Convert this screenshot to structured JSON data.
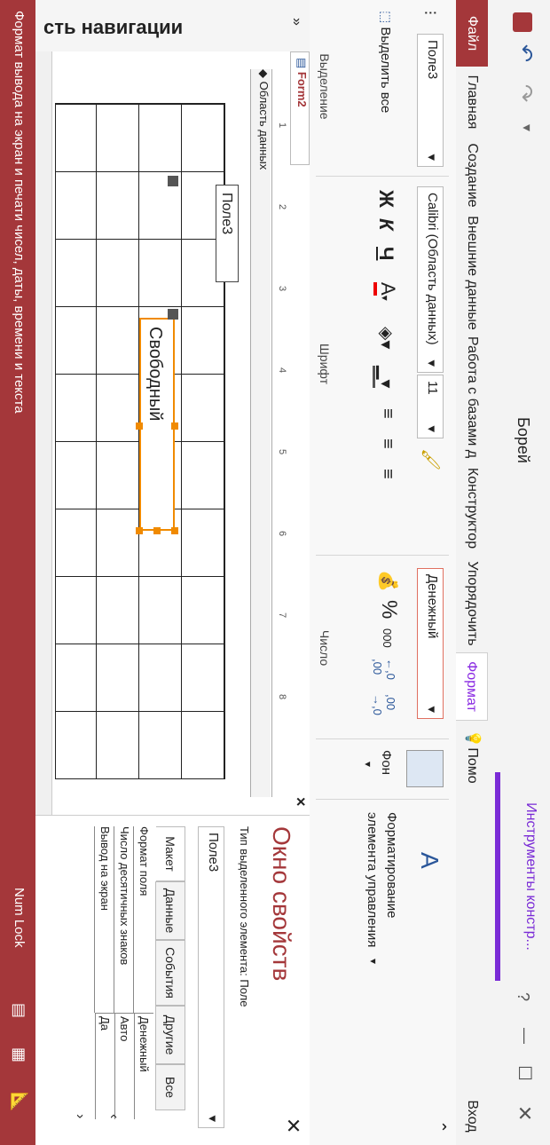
{
  "title_bar": {
    "doc_title": "Борей",
    "tools_context": "Инструменты констр...",
    "help_icon": "?",
    "minimize_icon": "—",
    "maximize_icon": "☐",
    "close_icon": "✕"
  },
  "tabs": {
    "file": "Файл",
    "home": "Главная",
    "create": "Создание",
    "external": "Внешние данные",
    "database": "Работа с базами д",
    "constructor": "Конструктор",
    "arrange": "Упорядочить",
    "format": "Формат",
    "help": "Помо",
    "signin": "Вход"
  },
  "ribbon": {
    "object_select_value": "Поле3",
    "select_all_label": "Выделить все",
    "selection_group": "Выделение",
    "font_select_value": "Calibri (Область данных)",
    "size_select_value": "11",
    "bold": "Ж",
    "italic": "К",
    "underline": "Ч",
    "font_color_letter": "A",
    "font_group": "Шрифт",
    "number_format_value": "Денежный",
    "percent": "%",
    "thousands": "000",
    "increase_decimal": "←,0 ,00",
    "decrease_decimal": ",00 →,0",
    "number_group": "Число",
    "background_label": "Фон",
    "conditional_label_1": "Форматирование",
    "conditional_label_2": "элемента управления"
  },
  "nav_pane": {
    "title": "сть навигации",
    "toggle": "»"
  },
  "document": {
    "tab_label": "Form2",
    "close": "×",
    "section_label": "Область данных",
    "ruler_marks": [
      "1",
      "2",
      "3",
      "4",
      "5",
      "6",
      "7",
      "8"
    ],
    "label_control": "Поле3",
    "text_control": "Свободный"
  },
  "property_sheet": {
    "title": "Окно свойств",
    "selection_type": "Тип выделенного элемента:  Поле",
    "object_value": "Поле3",
    "tabs": [
      "Макет",
      "Данные",
      "События",
      "Другие",
      "Все"
    ],
    "rows": [
      {
        "name": "Формат поля",
        "value": "Денежный"
      },
      {
        "name": "Число десятичных знаков",
        "value": "Авто"
      },
      {
        "name": "Вывод на экран",
        "value": "Да"
      }
    ]
  },
  "status_bar": {
    "message": "Формат вывода на экран и печати чисел, даты, времени и текста",
    "num_lock": "Num Lock"
  }
}
